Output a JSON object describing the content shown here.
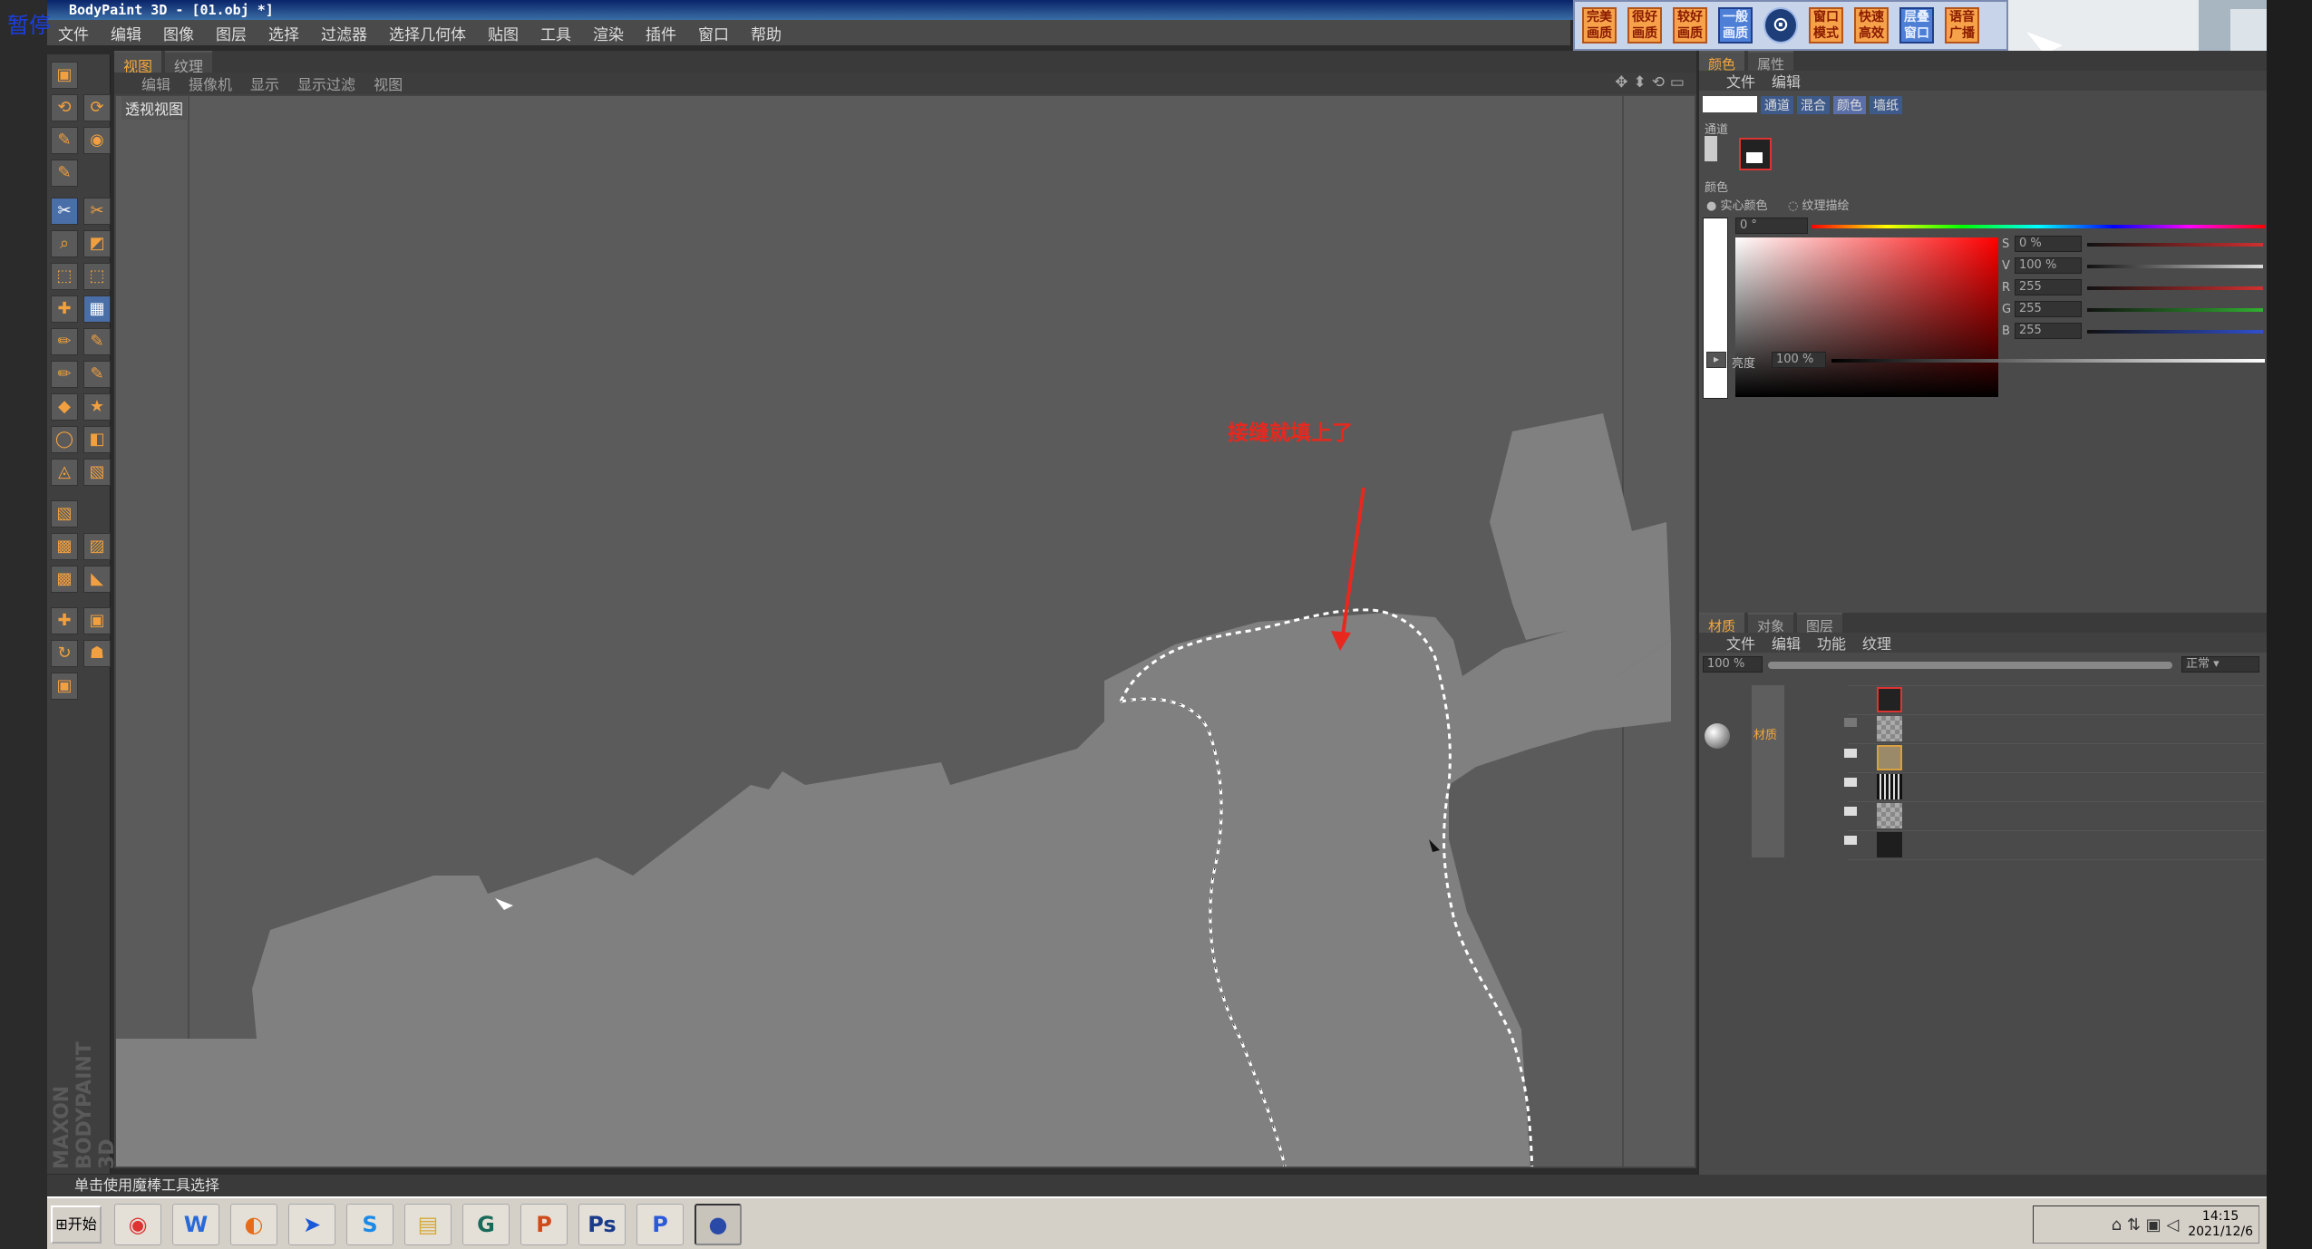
{
  "overlay": {
    "pause_label": "暂停"
  },
  "window": {
    "title": "BodyPaint 3D - [01.obj *]"
  },
  "menubar": [
    "文件",
    "编辑",
    "图像",
    "图层",
    "选择",
    "过滤器",
    "选择几何体",
    "贴图",
    "工具",
    "渲染",
    "插件",
    "窗口",
    "帮助"
  ],
  "quickbar": [
    {
      "label": "完美画质",
      "style": "orange"
    },
    {
      "label": "很好画质",
      "style": "orange"
    },
    {
      "label": "较好画质",
      "style": "orange"
    },
    {
      "label": "一般画质",
      "style": "blue"
    },
    {
      "label": "⊙",
      "style": "round"
    },
    {
      "label": "窗口模式",
      "style": "orange"
    },
    {
      "label": "快速高效",
      "style": "orange"
    },
    {
      "label": "层叠窗口",
      "style": "blue"
    },
    {
      "label": "语音广播",
      "style": "orange"
    }
  ],
  "viewport": {
    "tabs": [
      {
        "label": "视图",
        "active": true
      },
      {
        "label": "纹理",
        "active": false
      }
    ],
    "menu": [
      "编辑",
      "摄像机",
      "显示",
      "显示过滤",
      "视图"
    ],
    "label": "透视视图",
    "annotation": "接缝就填上了"
  },
  "color_panel": {
    "tabs": [
      {
        "label": "颜色",
        "active": true
      },
      {
        "label": "属性",
        "active": false
      }
    ],
    "menu": [
      "文件",
      "编辑"
    ],
    "subtabs": [
      "通道",
      "混合",
      "颜色",
      "墙纸"
    ],
    "channel_label": "通道",
    "color_label": "颜色",
    "radio_solid": "实心颜色",
    "radio_texture": "纹理描绘",
    "hue_value": "0 °",
    "sliders": [
      {
        "name": "S",
        "value": "0 %",
        "color": "#d03030"
      },
      {
        "name": "V",
        "value": "100 %",
        "color": "#dddddd"
      },
      {
        "name": "R",
        "value": "255",
        "color": "#d03030"
      },
      {
        "name": "G",
        "value": "255",
        "color": "#30b030"
      },
      {
        "name": "B",
        "value": "255",
        "color": "#3050d0"
      }
    ],
    "brightness_label": "亮度",
    "brightness_value": "100 %"
  },
  "material_panel": {
    "tabs": [
      {
        "label": "材质",
        "active": true
      },
      {
        "label": "对象",
        "active": false
      },
      {
        "label": "图层",
        "active": false
      }
    ],
    "menu": [
      "文件",
      "编辑",
      "功能",
      "纹理"
    ],
    "opacity_value": "100 %",
    "blend_mode": "正常",
    "material_name": "材质"
  },
  "status": {
    "text": "单击使用魔棒工具选择"
  },
  "taskbar": {
    "start_label": "开始",
    "apps": [
      {
        "name": "chrome",
        "glyph": "◉",
        "color": "#d33"
      },
      {
        "name": "wps",
        "glyph": "W",
        "color": "#2a6ad8"
      },
      {
        "name": "firefox",
        "glyph": "◐",
        "color": "#e86b1a"
      },
      {
        "name": "feishu",
        "glyph": "➤",
        "color": "#1a5ad8"
      },
      {
        "name": "s-app",
        "glyph": "S",
        "color": "#1a8ae8"
      },
      {
        "name": "explorer",
        "glyph": "▤",
        "color": "#d8a83a"
      },
      {
        "name": "g-app",
        "glyph": "G",
        "color": "#1a6a5a"
      },
      {
        "name": "powerpoint",
        "glyph": "P",
        "color": "#d04a1a"
      },
      {
        "name": "photoshop",
        "glyph": "Ps",
        "color": "#1a3a8a"
      },
      {
        "name": "p-app",
        "glyph": "P",
        "color": "#2a5ad8"
      },
      {
        "name": "bodypaint",
        "glyph": "●",
        "color": "#2a4aa8"
      }
    ],
    "clock_time": "14:15",
    "clock_date": "2021/12/6"
  },
  "colors": {
    "accent": "#f4a83a",
    "viewport_bg": "#5b5b5b",
    "model": "#7f7f7f",
    "annotation": "#e8281e"
  }
}
